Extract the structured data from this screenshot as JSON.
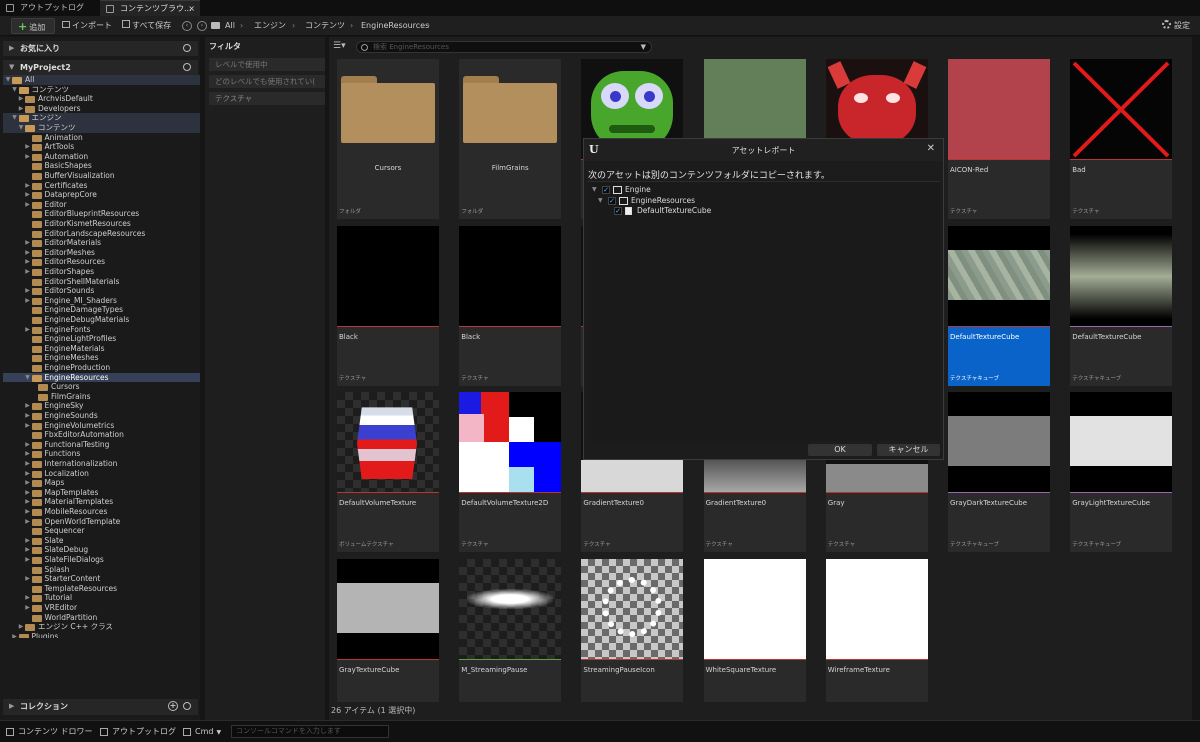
{
  "window_tabs": [
    {
      "label": "アウトプットログ"
    },
    {
      "label": "コンテンツブラウ...",
      "close": "×"
    }
  ],
  "toolbar": {
    "add": "追加",
    "import": "インポート",
    "save_all": "すべて保存",
    "settings": "設定",
    "breadcrumb": [
      "All",
      "エンジン",
      "コンテンツ",
      "EngineResources"
    ]
  },
  "sidebar": {
    "favorites": "お気に入り",
    "project": "MyProject2",
    "collections": "コレクション"
  },
  "tree": [
    {
      "label": "All",
      "indent": 0,
      "arrow": "down",
      "folder": "open",
      "hl": true
    },
    {
      "label": "コンテンツ",
      "indent": 1,
      "arrow": "down",
      "folder": "open"
    },
    {
      "label": "ArchvisDefault",
      "indent": 2,
      "arrow": "right",
      "folder": "closed"
    },
    {
      "label": "Developers",
      "indent": 2,
      "arrow": "right",
      "folder": "closed"
    },
    {
      "label": "エンジン",
      "indent": 1,
      "arrow": "down",
      "folder": "open",
      "hl": true
    },
    {
      "label": "コンテンツ",
      "indent": 2,
      "arrow": "down",
      "folder": "open",
      "hl": true
    },
    {
      "label": "Animation",
      "indent": 3,
      "arrow": "",
      "folder": "closed"
    },
    {
      "label": "ArtTools",
      "indent": 3,
      "arrow": "right",
      "folder": "closed"
    },
    {
      "label": "Automation",
      "indent": 3,
      "arrow": "right",
      "folder": "closed"
    },
    {
      "label": "BasicShapes",
      "indent": 3,
      "arrow": "",
      "folder": "closed"
    },
    {
      "label": "BufferVisualization",
      "indent": 3,
      "arrow": "",
      "folder": "closed"
    },
    {
      "label": "Certificates",
      "indent": 3,
      "arrow": "right",
      "folder": "closed"
    },
    {
      "label": "DataprepCore",
      "indent": 3,
      "arrow": "right",
      "folder": "closed"
    },
    {
      "label": "Editor",
      "indent": 3,
      "arrow": "right",
      "folder": "closed"
    },
    {
      "label": "EditorBlueprintResources",
      "indent": 3,
      "arrow": "",
      "folder": "closed"
    },
    {
      "label": "EditorKismetResources",
      "indent": 3,
      "arrow": "",
      "folder": "closed"
    },
    {
      "label": "EditorLandscapeResources",
      "indent": 3,
      "arrow": "",
      "folder": "closed"
    },
    {
      "label": "EditorMaterials",
      "indent": 3,
      "arrow": "right",
      "folder": "closed"
    },
    {
      "label": "EditorMeshes",
      "indent": 3,
      "arrow": "right",
      "folder": "closed"
    },
    {
      "label": "EditorResources",
      "indent": 3,
      "arrow": "right",
      "folder": "closed"
    },
    {
      "label": "EditorShapes",
      "indent": 3,
      "arrow": "right",
      "folder": "closed"
    },
    {
      "label": "EditorShellMaterials",
      "indent": 3,
      "arrow": "",
      "folder": "closed"
    },
    {
      "label": "EditorSounds",
      "indent": 3,
      "arrow": "right",
      "folder": "closed"
    },
    {
      "label": "Engine_MI_Shaders",
      "indent": 3,
      "arrow": "right",
      "folder": "closed"
    },
    {
      "label": "EngineDamageTypes",
      "indent": 3,
      "arrow": "",
      "folder": "closed"
    },
    {
      "label": "EngineDebugMaterials",
      "indent": 3,
      "arrow": "",
      "folder": "closed"
    },
    {
      "label": "EngineFonts",
      "indent": 3,
      "arrow": "right",
      "folder": "closed"
    },
    {
      "label": "EngineLightProfiles",
      "indent": 3,
      "arrow": "",
      "folder": "closed"
    },
    {
      "label": "EngineMaterials",
      "indent": 3,
      "arrow": "",
      "folder": "closed"
    },
    {
      "label": "EngineMeshes",
      "indent": 3,
      "arrow": "",
      "folder": "closed"
    },
    {
      "label": "EngineProduction",
      "indent": 3,
      "arrow": "",
      "folder": "closed"
    },
    {
      "label": "EngineResources",
      "indent": 3,
      "arrow": "down",
      "folder": "open",
      "selected": true
    },
    {
      "label": "Cursors",
      "indent": 4,
      "arrow": "",
      "folder": "closed"
    },
    {
      "label": "FilmGrains",
      "indent": 4,
      "arrow": "",
      "folder": "closed"
    },
    {
      "label": "EngineSky",
      "indent": 3,
      "arrow": "right",
      "folder": "closed"
    },
    {
      "label": "EngineSounds",
      "indent": 3,
      "arrow": "right",
      "folder": "closed"
    },
    {
      "label": "EngineVolumetrics",
      "indent": 3,
      "arrow": "right",
      "folder": "closed"
    },
    {
      "label": "FbxEditorAutomation",
      "indent": 3,
      "arrow": "",
      "folder": "closed"
    },
    {
      "label": "FunctionalTesting",
      "indent": 3,
      "arrow": "right",
      "folder": "closed"
    },
    {
      "label": "Functions",
      "indent": 3,
      "arrow": "right",
      "folder": "closed"
    },
    {
      "label": "Internationalization",
      "indent": 3,
      "arrow": "right",
      "folder": "closed"
    },
    {
      "label": "Localization",
      "indent": 3,
      "arrow": "right",
      "folder": "closed"
    },
    {
      "label": "Maps",
      "indent": 3,
      "arrow": "right",
      "folder": "closed"
    },
    {
      "label": "MapTemplates",
      "indent": 3,
      "arrow": "right",
      "folder": "closed"
    },
    {
      "label": "MaterialTemplates",
      "indent": 3,
      "arrow": "right",
      "folder": "closed"
    },
    {
      "label": "MobileResources",
      "indent": 3,
      "arrow": "right",
      "folder": "closed"
    },
    {
      "label": "OpenWorldTemplate",
      "indent": 3,
      "arrow": "right",
      "folder": "closed"
    },
    {
      "label": "Sequencer",
      "indent": 3,
      "arrow": "",
      "folder": "closed"
    },
    {
      "label": "Slate",
      "indent": 3,
      "arrow": "right",
      "folder": "closed"
    },
    {
      "label": "SlateDebug",
      "indent": 3,
      "arrow": "right",
      "folder": "closed"
    },
    {
      "label": "SlateFileDialogs",
      "indent": 3,
      "arrow": "right",
      "folder": "closed"
    },
    {
      "label": "Splash",
      "indent": 3,
      "arrow": "",
      "folder": "closed"
    },
    {
      "label": "StarterContent",
      "indent": 3,
      "arrow": "right",
      "folder": "closed"
    },
    {
      "label": "TemplateResources",
      "indent": 3,
      "arrow": "",
      "folder": "closed"
    },
    {
      "label": "Tutorial",
      "indent": 3,
      "arrow": "right",
      "folder": "closed"
    },
    {
      "label": "VREditor",
      "indent": 3,
      "arrow": "right",
      "folder": "closed"
    },
    {
      "label": "WorldPartition",
      "indent": 3,
      "arrow": "",
      "folder": "closed"
    },
    {
      "label": "エンジン C++ クラス",
      "indent": 2,
      "arrow": "right",
      "folder": "closed"
    },
    {
      "label": "Plugins",
      "indent": 1,
      "arrow": "right",
      "folder": "closed"
    }
  ],
  "filters": {
    "title": "フィルタ",
    "items": [
      "レベルで使用中",
      "どのレベルでも使用されてい(",
      "テクスチャ"
    ]
  },
  "search": {
    "placeholder": "検索 EngineResources"
  },
  "assets": [
    {
      "name": "Cursors",
      "type": "フォルダ",
      "thumb": "folder"
    },
    {
      "name": "FilmGrains",
      "type": "フォルダ",
      "thumb": "folder"
    },
    {
      "name": "",
      "type": "",
      "thumb": "frog"
    },
    {
      "name": "",
      "type": "",
      "thumb": "green"
    },
    {
      "name": "",
      "type": "",
      "thumb": "demon"
    },
    {
      "name": "AICON-Red",
      "type": "テクスチャ",
      "thumb": "redflat"
    },
    {
      "name": "Bad",
      "type": "テクスチャ",
      "thumb": "bad"
    },
    {
      "name": "Black",
      "type": "テクスチャ",
      "thumb": "black"
    },
    {
      "name": "Black",
      "type": "テクスチャ",
      "thumb": "black"
    },
    {
      "name": "",
      "type": "",
      "thumb": "hidden"
    },
    {
      "name": "",
      "type": "",
      "thumb": "hidden"
    },
    {
      "name": "",
      "type": "",
      "thumb": "hidden"
    },
    {
      "name": "DefaultTextureCube",
      "type": "テクスチャキューブ",
      "thumb": "cubemap",
      "selected": true
    },
    {
      "name": "DefaultTextureCube",
      "type": "テクスチャキューブ",
      "thumb": "gradband"
    },
    {
      "name": "DefaultVolumeTexture",
      "type": "ボリュームテクスチャ",
      "thumb": "volume"
    },
    {
      "name": "DefaultVolumeTexture2D",
      "type": "テクスチャ",
      "thumb": "volume2d"
    },
    {
      "name": "GradientTexture0",
      "type": "テクスチャ",
      "thumb": "gradlight"
    },
    {
      "name": "GradientTexture0",
      "type": "テクスチャ",
      "thumb": "graddark"
    },
    {
      "name": "Gray",
      "type": "テクスチャ",
      "thumb": "graybottom"
    },
    {
      "name": "GrayDarkTextureCube",
      "type": "テクスチャキューブ",
      "thumb": "darkband"
    },
    {
      "name": "GrayLightTextureCube",
      "type": "テクスチャキューブ",
      "thumb": "lightband"
    },
    {
      "name": "GrayTextureCube",
      "type": "",
      "thumb": "grayband"
    },
    {
      "name": "M_StreamingPause",
      "type": "",
      "thumb": "streaming"
    },
    {
      "name": "StreamingPauseIcon",
      "type": "",
      "thumb": "pauseicon"
    },
    {
      "name": "WhiteSquareTexture",
      "type": "",
      "thumb": "white"
    },
    {
      "name": "WireframeTexture",
      "type": "",
      "thumb": "white"
    }
  ],
  "item_count": "26 アイテム (1 選択中)",
  "dialog": {
    "title": "アセットレポート",
    "message": "次のアセットは別のコンテンツフォルダにコピーされます。",
    "tree": [
      {
        "label": "Engine",
        "indent": 0,
        "icon": "folder-open"
      },
      {
        "label": "EngineResources",
        "indent": 1,
        "icon": "folder-open"
      },
      {
        "label": "DefaultTextureCube",
        "indent": 2,
        "icon": "file"
      }
    ],
    "ok": "OK",
    "cancel": "キャンセル",
    "logo": "U"
  },
  "statusbar": {
    "content_drawer": "コンテンツ ドロワー",
    "output_log": "アウトプットログ",
    "cmd": "Cmd",
    "console_placeholder": "コンソールコマンドを入力します"
  },
  "colors": {
    "selection": "#0a63c9",
    "tree_selection": "#364159",
    "add_plus": "#63c75c"
  }
}
